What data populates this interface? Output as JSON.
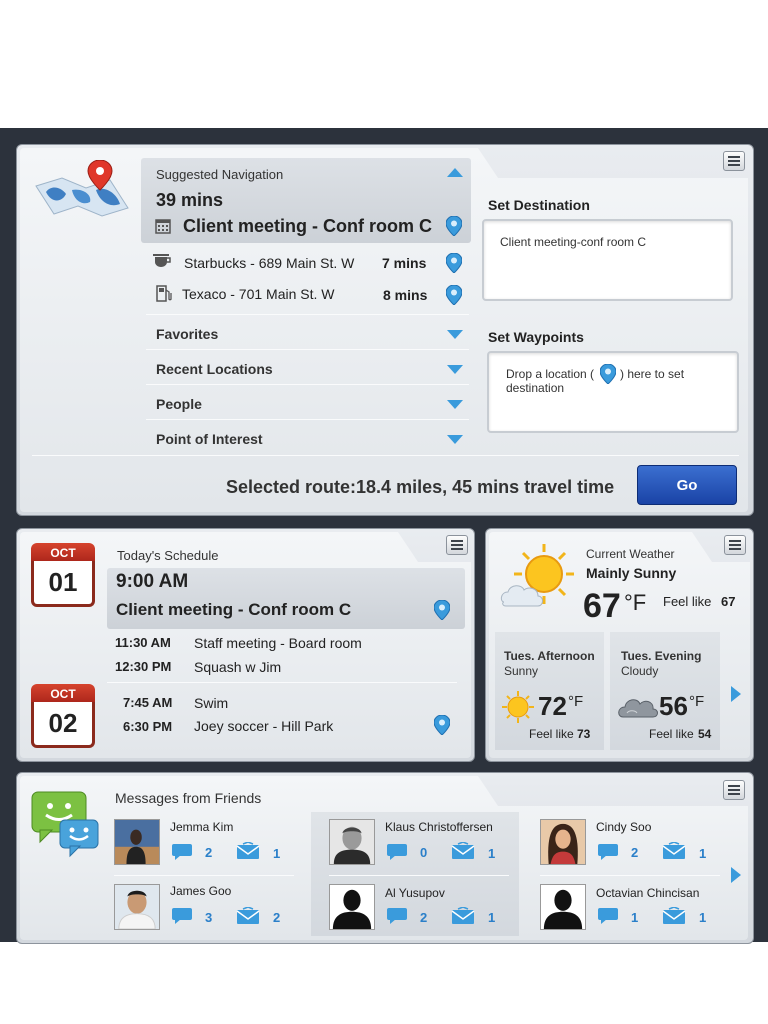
{
  "navigation": {
    "suggested_label": "Suggested Navigation",
    "duration": "39 mins",
    "event": "Client meeting - Conf room C",
    "stops": [
      {
        "name": "Starbucks - 689 Main St. W",
        "time": "7 mins",
        "icon": "coffee-icon"
      },
      {
        "name": "Texaco - 701 Main St. W",
        "time": "8 mins",
        "icon": "gas-pump-icon"
      }
    ],
    "sections": [
      "Favorites",
      "Recent Locations",
      "People",
      "Point of Interest"
    ],
    "set_destination_label": "Set Destination",
    "destination_value": "Client meeting-conf room C",
    "set_waypoints_label": "Set Waypoints",
    "waypoints_hint_1": "Drop a location (",
    "waypoints_hint_2": ") here to set",
    "waypoints_hint_3": "destination",
    "selected_route": "Selected route:18.4 miles, 45 mins travel time",
    "go_label": "Go"
  },
  "schedule": {
    "title": "Today's Schedule",
    "day1": {
      "month": "OCT",
      "day": "01"
    },
    "day2": {
      "month": "OCT",
      "day": "02"
    },
    "highlight_time": "9:00 AM",
    "highlight_event": "Client meeting - Conf room C",
    "events_day1": [
      {
        "time": "11:30 AM",
        "event": "Staff meeting - Board room"
      },
      {
        "time": "12:30 PM",
        "event": "Squash w Jim"
      }
    ],
    "events_day2": [
      {
        "time": "7:45 AM",
        "event": "Swim"
      },
      {
        "time": "6:30 PM",
        "event": "Joey soccer - Hill Park"
      }
    ]
  },
  "weather": {
    "title": "Current Weather",
    "condition": "Mainly Sunny",
    "temp": "67",
    "unit": "°F",
    "feel_label": "Feel like",
    "feel": "67",
    "forecasts": [
      {
        "period": "Tues. Afternoon",
        "condition": "Sunny",
        "temp": "72",
        "unit": "°F",
        "feel_label": "Feel like",
        "feel": "73"
      },
      {
        "period": "Tues. Evening",
        "condition": "Cloudy",
        "temp": "56",
        "unit": "°F",
        "feel_label": "Feel like",
        "feel": "54"
      }
    ]
  },
  "messages": {
    "title": "Messages from Friends",
    "friends": [
      {
        "name": "Jemma Kim",
        "chats": "2",
        "mails": "1"
      },
      {
        "name": "James Goo",
        "chats": "3",
        "mails": "2"
      },
      {
        "name": "Klaus Christoffersen",
        "chats": "0",
        "mails": "1"
      },
      {
        "name": "Al Yusupov",
        "chats": "2",
        "mails": "1"
      },
      {
        "name": "Cindy Soo",
        "chats": "2",
        "mails": "1"
      },
      {
        "name": "Octavian Chincisan",
        "chats": "1",
        "mails": "1"
      }
    ]
  },
  "colors": {
    "accent": "#3a9bdc",
    "go_button": "#1a43a6",
    "calendar_red": "#c0321f",
    "background": "#2c323c"
  }
}
